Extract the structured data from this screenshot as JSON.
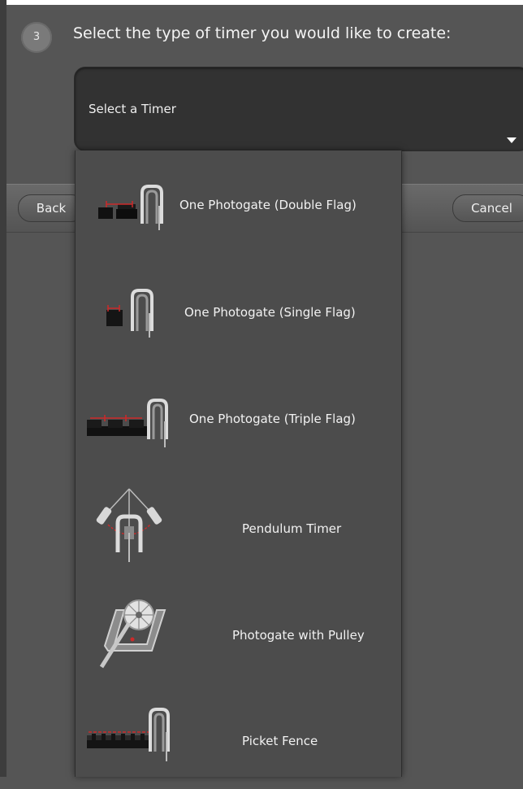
{
  "step": {
    "number": "3",
    "title": "Select the type of timer you would like to create:"
  },
  "select": {
    "value": "Select a Timer"
  },
  "nav": {
    "back_label": "Back",
    "cancel_label": "Cancel"
  },
  "options": [
    {
      "label": "One Photogate (Double Flag)",
      "icon": "double-flag-photogate-icon"
    },
    {
      "label": "One Photogate (Single Flag)",
      "icon": "single-flag-photogate-icon"
    },
    {
      "label": "One Photogate (Triple Flag)",
      "icon": "triple-flag-photogate-icon"
    },
    {
      "label": "Pendulum Timer",
      "icon": "pendulum-timer-icon"
    },
    {
      "label": "Photogate with Pulley",
      "icon": "photogate-pulley-icon"
    },
    {
      "label": "Picket Fence",
      "icon": "picket-fence-icon"
    }
  ],
  "colors": {
    "background": "#555555",
    "dropdown": "#4c4c4c",
    "select_box": "#323232",
    "beam_red": "#cc2a2a"
  }
}
